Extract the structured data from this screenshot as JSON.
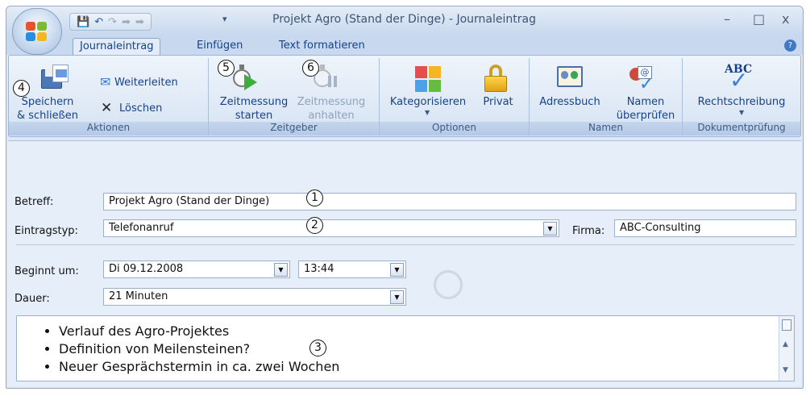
{
  "window": {
    "title": "Projekt Agro (Stand der Dinge) - Journaleintrag",
    "controls": [
      "–",
      "□",
      "x"
    ]
  },
  "ribbon_tabs": [
    {
      "label": "Journaleintrag",
      "active": true
    },
    {
      "label": "Einfügen",
      "active": false
    },
    {
      "label": "Text formatieren",
      "active": false
    }
  ],
  "groups": {
    "aktionen": {
      "name": "Aktionen",
      "save_close": "Speichern\n& schließen",
      "forward": "Weiterleiten",
      "delete": "Löschen"
    },
    "zeitgeber": {
      "name": "Zeitgeber",
      "start": "Zeitmessung\nstarten",
      "stop": "Zeitmessung\nanhalten"
    },
    "optionen": {
      "name": "Optionen",
      "categorize": "Kategorisieren",
      "private": "Privat"
    },
    "namen": {
      "name": "Namen",
      "addressbook": "Adressbuch",
      "check_names": "Namen\nüberprüfen"
    },
    "dokumentpruefung": {
      "name": "Dokumentprüfung",
      "spelling": "Rechtschreibung",
      "abc": "ABC"
    }
  },
  "callouts": [
    "1",
    "2",
    "3",
    "4",
    "5",
    "6"
  ],
  "form": {
    "subject_label": "Betreff:",
    "subject_value": "Projekt Agro (Stand der Dinge)",
    "entry_type_label": "Eintragstyp:",
    "entry_type_value": "Telefonanruf",
    "company_label": "Firma:",
    "company_value": "ABC-Consulting",
    "start_label": "Beginnt um:",
    "start_date": "Di 09.12.2008",
    "start_time": "13:44",
    "duration_label": "Dauer:",
    "duration_value": "21 Minuten"
  },
  "body_items": [
    "Verlauf des Agro-Projektes",
    "Definition von Meilensteinen?",
    "Neuer Gesprächstermin in ca. zwei Wochen"
  ],
  "colors": {
    "accent": "#15428b",
    "ribbon_bg": "#dfe9f5"
  }
}
